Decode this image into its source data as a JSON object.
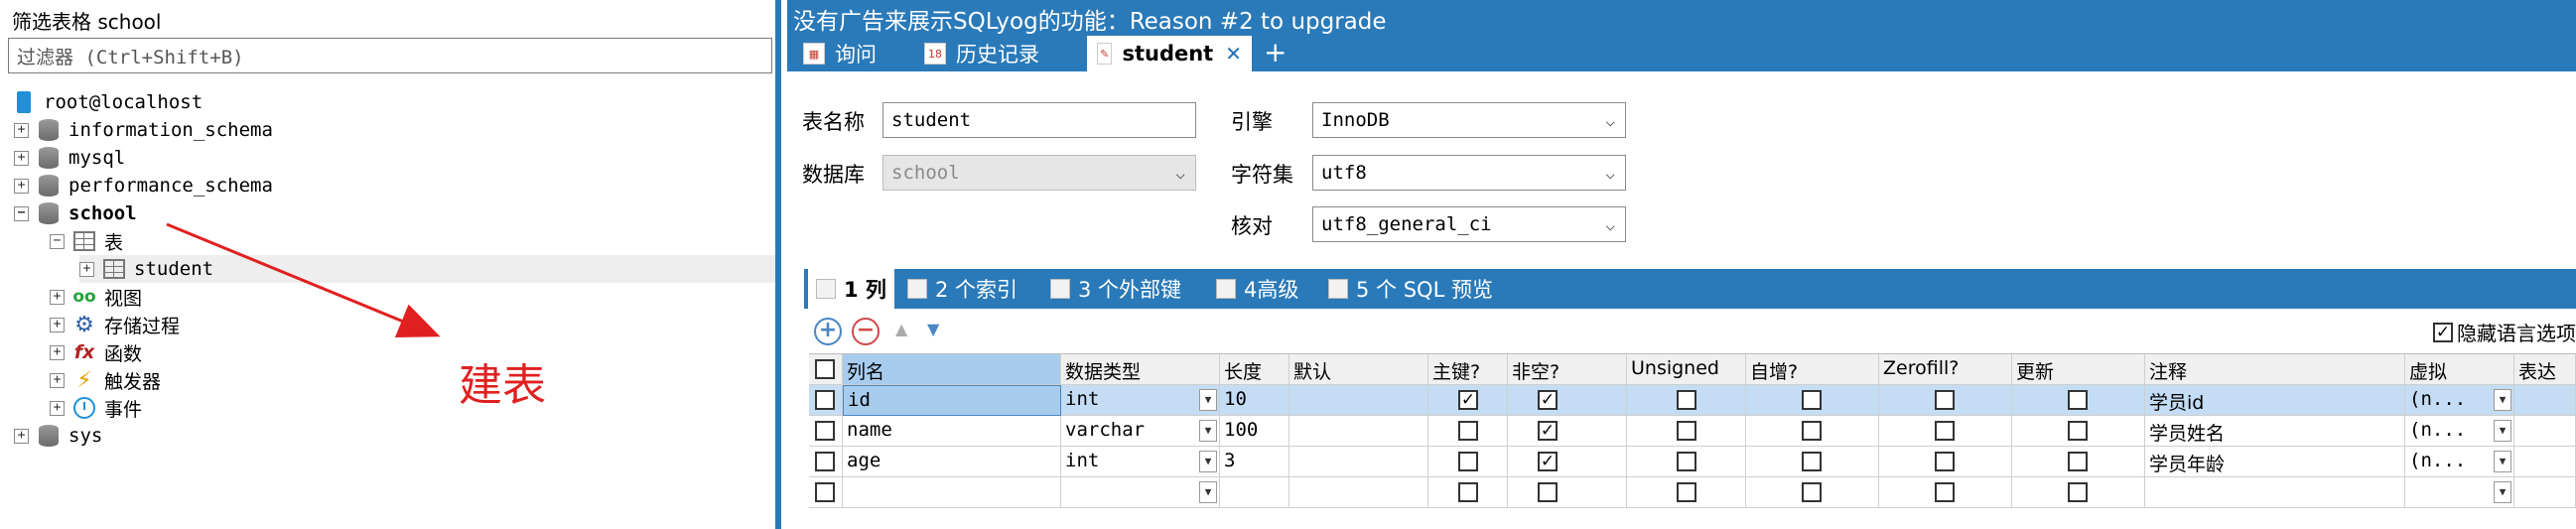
{
  "left_panel": {
    "title": "筛选表格 school",
    "filter_placeholder": "过滤器 (Ctrl+Shift+B)",
    "tree": {
      "root": "root@localhost",
      "databases": [
        "information_schema",
        "mysql",
        "performance_schema",
        "school",
        "sys"
      ],
      "school_children": {
        "tables_label": "表",
        "table_student": "student",
        "views": "视图",
        "procedures": "存储过程",
        "functions": "函数",
        "triggers": "触发器",
        "events": "事件"
      }
    },
    "annotation": "建表",
    "annotation_color": "#e02020"
  },
  "ad_bar": {
    "text": "没有广告来展示SQLyog的功能：Reason #2 to upgrade"
  },
  "tabs": [
    {
      "label": "询问",
      "active": false
    },
    {
      "label": "历史记录",
      "active": false
    },
    {
      "label": "student",
      "active": true
    }
  ],
  "form": {
    "table_name_label": "表名称",
    "table_name_value": "student",
    "database_label": "数据库",
    "database_value": "school",
    "engine_label": "引擎",
    "engine_value": "InnoDB",
    "charset_label": "字符集",
    "charset_value": "utf8",
    "collation_label": "核对",
    "collation_value": "utf8_general_ci"
  },
  "sub_tabs": [
    {
      "label": "1 列",
      "active": true
    },
    {
      "label": "2 个索引",
      "active": false
    },
    {
      "label": "3 个外部键",
      "active": false
    },
    {
      "label": "4高级",
      "active": false
    },
    {
      "label": "5 个 SQL 预览",
      "active": false
    }
  ],
  "toolbar": {
    "add_symbol": "+",
    "remove_symbol": "−",
    "up_symbol": "▲",
    "down_symbol": "▼",
    "hide_language_options": "隐藏语言选项",
    "hide_language_checked": true
  },
  "grid": {
    "columns": [
      "列名",
      "数据类型",
      "长度",
      "默认",
      "主键?",
      "非空?",
      "Unsigned",
      "自增?",
      "Zerofill?",
      "更新",
      "注释",
      "虚拟",
      "表达"
    ],
    "rows": [
      {
        "name": "id",
        "type": "int",
        "length": "10",
        "default": "",
        "pk": true,
        "notnull": true,
        "unsigned": false,
        "autoinc": false,
        "zerofill": false,
        "update": false,
        "comment": "学员id",
        "virtual": "(n..."
      },
      {
        "name": "name",
        "type": "varchar",
        "length": "100",
        "default": "",
        "pk": false,
        "notnull": true,
        "unsigned": false,
        "autoinc": false,
        "zerofill": false,
        "update": false,
        "comment": "学员姓名",
        "virtual": "(n..."
      },
      {
        "name": "age",
        "type": "int",
        "length": "3",
        "default": "",
        "pk": false,
        "notnull": true,
        "unsigned": false,
        "autoinc": false,
        "zerofill": false,
        "update": false,
        "comment": "学员年龄",
        "virtual": "(n..."
      },
      {
        "name": "",
        "type": "",
        "length": "",
        "default": "",
        "pk": false,
        "notnull": false,
        "unsigned": false,
        "autoinc": false,
        "zerofill": false,
        "update": false,
        "comment": "",
        "virtual": ""
      }
    ]
  },
  "colors": {
    "accent": "#2a7ab9",
    "selection": "#a8ccee"
  }
}
